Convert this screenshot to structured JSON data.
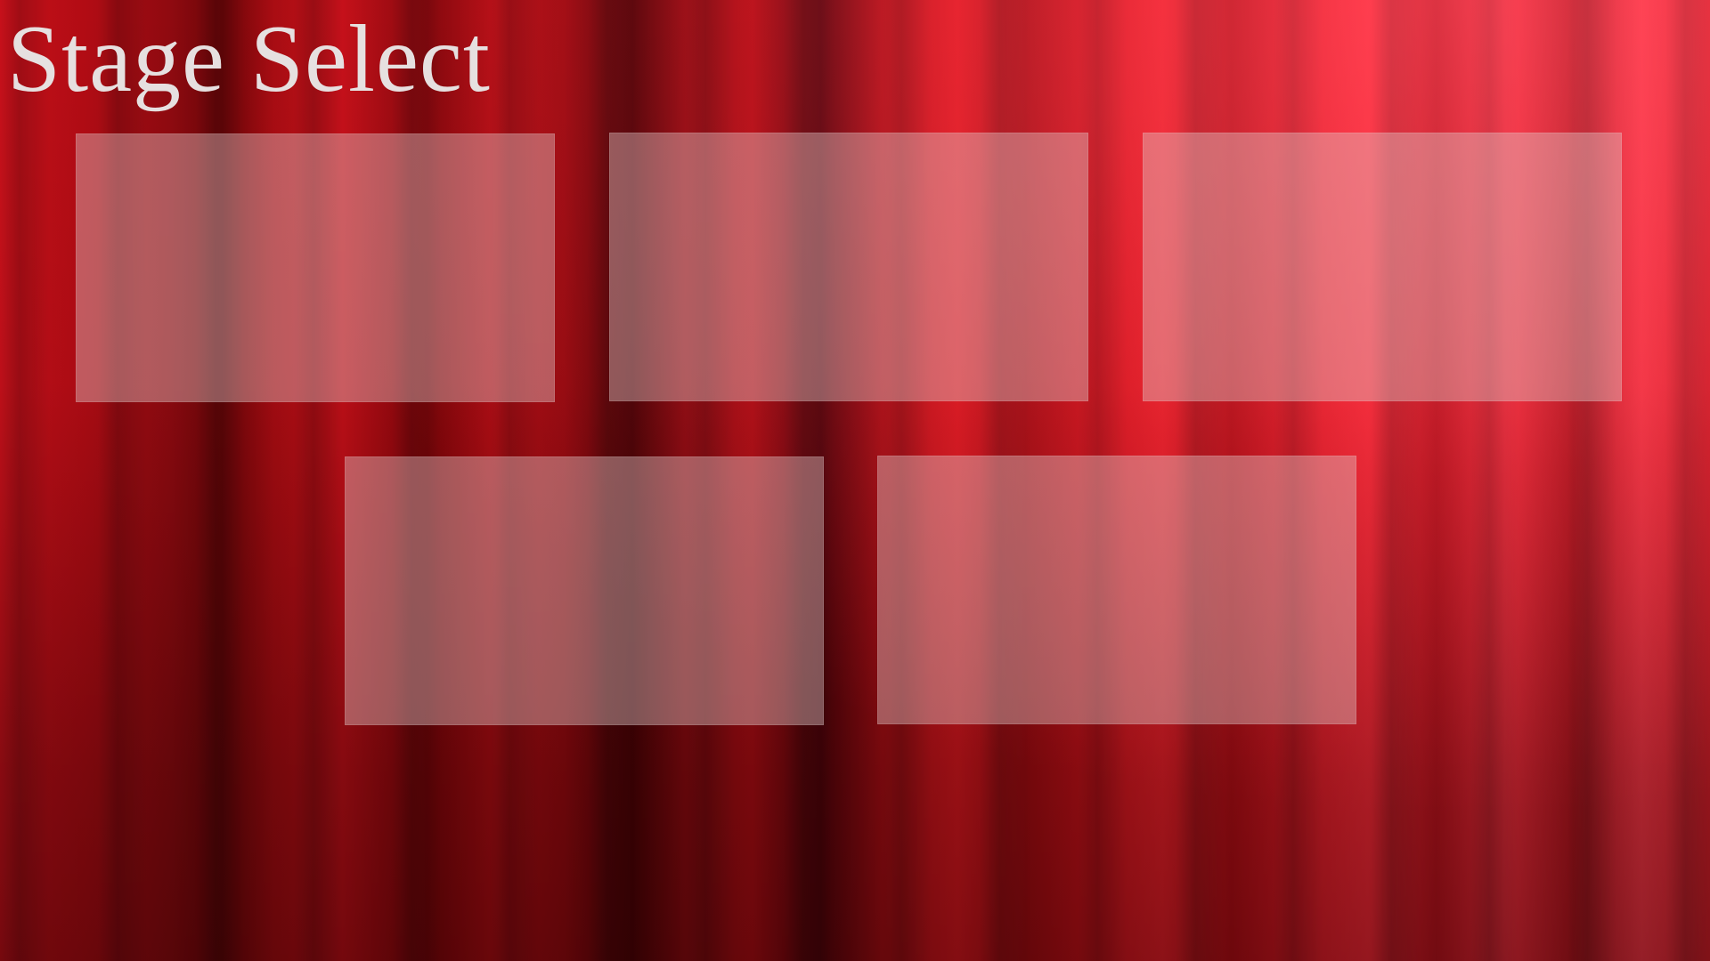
{
  "title": "Stage Select",
  "colors": {
    "title_text": "#e6e0e0",
    "curtain_primary": "#c40f18",
    "curtain_shadow": "#3a0104",
    "curtain_highlight": "#ff3848",
    "card_fill": "rgba(225,200,200,0.42)"
  },
  "stages": [
    {
      "label": ""
    },
    {
      "label": ""
    },
    {
      "label": ""
    },
    {
      "label": ""
    },
    {
      "label": ""
    }
  ]
}
